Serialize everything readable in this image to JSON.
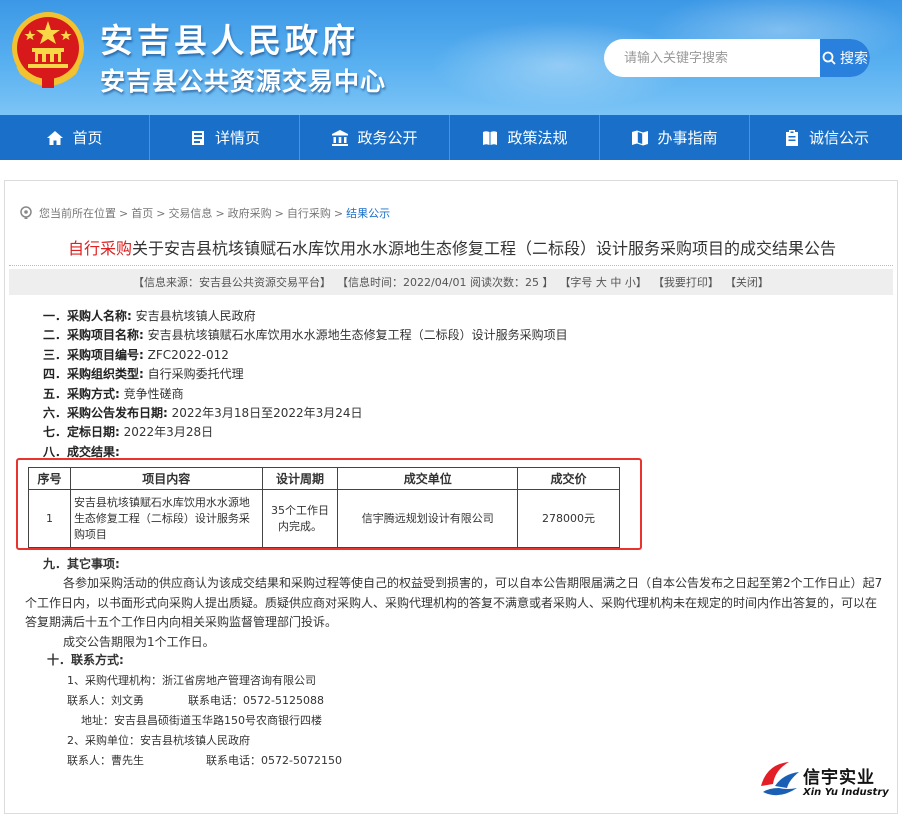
{
  "header": {
    "title_line1": "安吉县人民政府",
    "title_line2": "安吉县公共资源交易中心",
    "search_placeholder": "请输入关键字搜索",
    "search_button": "搜索"
  },
  "nav": {
    "items": [
      {
        "label": "首页",
        "icon": "home-icon"
      },
      {
        "label": "详情页",
        "icon": "list-icon"
      },
      {
        "label": "政务公开",
        "icon": "building-icon"
      },
      {
        "label": "政策法规",
        "icon": "book-icon"
      },
      {
        "label": "办事指南",
        "icon": "map-icon"
      },
      {
        "label": "诚信公示",
        "icon": "clipboard-icon"
      }
    ]
  },
  "breadcrumb": {
    "prefix": "您当前所在位置",
    "items": [
      "首页",
      "交易信息",
      "政府采购",
      "自行采购",
      "结果公示"
    ]
  },
  "article": {
    "title_tag": "自行采购",
    "title_text": "关于安吉县杭垓镇赋石水库饮用水水源地生态修复工程（二标段）设计服务采购项目的成交结果公告",
    "info": {
      "source": "【信息来源：安吉县公共资源交易平台】",
      "time": "【信息时间：2022/04/01 阅读次数：25 】",
      "font_size": "【字号 大 中 小】",
      "print": "【我要打印】",
      "close": "【关闭】"
    }
  },
  "items": [
    {
      "label": "一．采购人名称:",
      "value": "安吉县杭垓镇人民政府"
    },
    {
      "label": "二．采购项目名称:",
      "value": "安吉县杭垓镇赋石水库饮用水水源地生态修复工程（二标段）设计服务采购项目"
    },
    {
      "label": "三．采购项目编号:",
      "value": "ZFC2022-012"
    },
    {
      "label": "四．采购组织类型:",
      "value": "自行采购委托代理"
    },
    {
      "label": "五．采购方式:",
      "value": "竞争性磋商"
    },
    {
      "label": "六．采购公告发布日期:",
      "value": "2022年3月18日至2022年3月24日"
    },
    {
      "label": "七．定标日期:",
      "value": "2022年3月28日"
    },
    {
      "label": "八．成交结果:",
      "value": ""
    }
  ],
  "result_table": {
    "headers": [
      "序号",
      "项目内容",
      "设计周期",
      "成交单位",
      "成交价"
    ],
    "rows": [
      {
        "no": "1",
        "content": "安吉县杭垓镇赋石水库饮用水水源地生态修复工程（二标段）设计服务采购项目",
        "period": "35个工作日内完成。",
        "winner": "信宇腾远规划设计有限公司",
        "price": "278000元"
      }
    ]
  },
  "section9": {
    "label": "九．其它事项:",
    "para1": "各参加采购活动的供应商认为该成交结果和采购过程等使自己的权益受到损害的，可以自本公告期限届满之日（自本公告发布之日起至第2个工作日止）起7个工作日内，以书面形式向采购人提出质疑。质疑供应商对采购人、采购代理机构的答复不满意或者采购人、采购代理机构未在规定的时间内作出答复的，可以在答复期满后十五个工作日内向相关采购监督管理部门投诉。",
    "para2": "成交公告期限为1个工作日。"
  },
  "section10": {
    "label": "十．联系方式:",
    "agency": "1、采购代理机构：浙江省房地产管理咨询有限公司",
    "agency_contact": "联系人：刘文勇",
    "agency_phone": "联系电话：0572-5125088",
    "agency_address": "地址：安吉县昌硕街道玉华路150号农商银行四楼",
    "buyer": "2、采购单位：安吉县杭垓镇人民政府",
    "buyer_contact": "联系人：曹先生",
    "buyer_phone": "联系电话：0572-5072150"
  },
  "watermark_logo": {
    "cn": "信宇实业",
    "en": "Xin Yu Industry"
  },
  "colors": {
    "header_blue": "#3c98e6",
    "nav_blue": "#1a70c8",
    "title_red": "#e02020",
    "highlight_frame": "#e8332e"
  }
}
